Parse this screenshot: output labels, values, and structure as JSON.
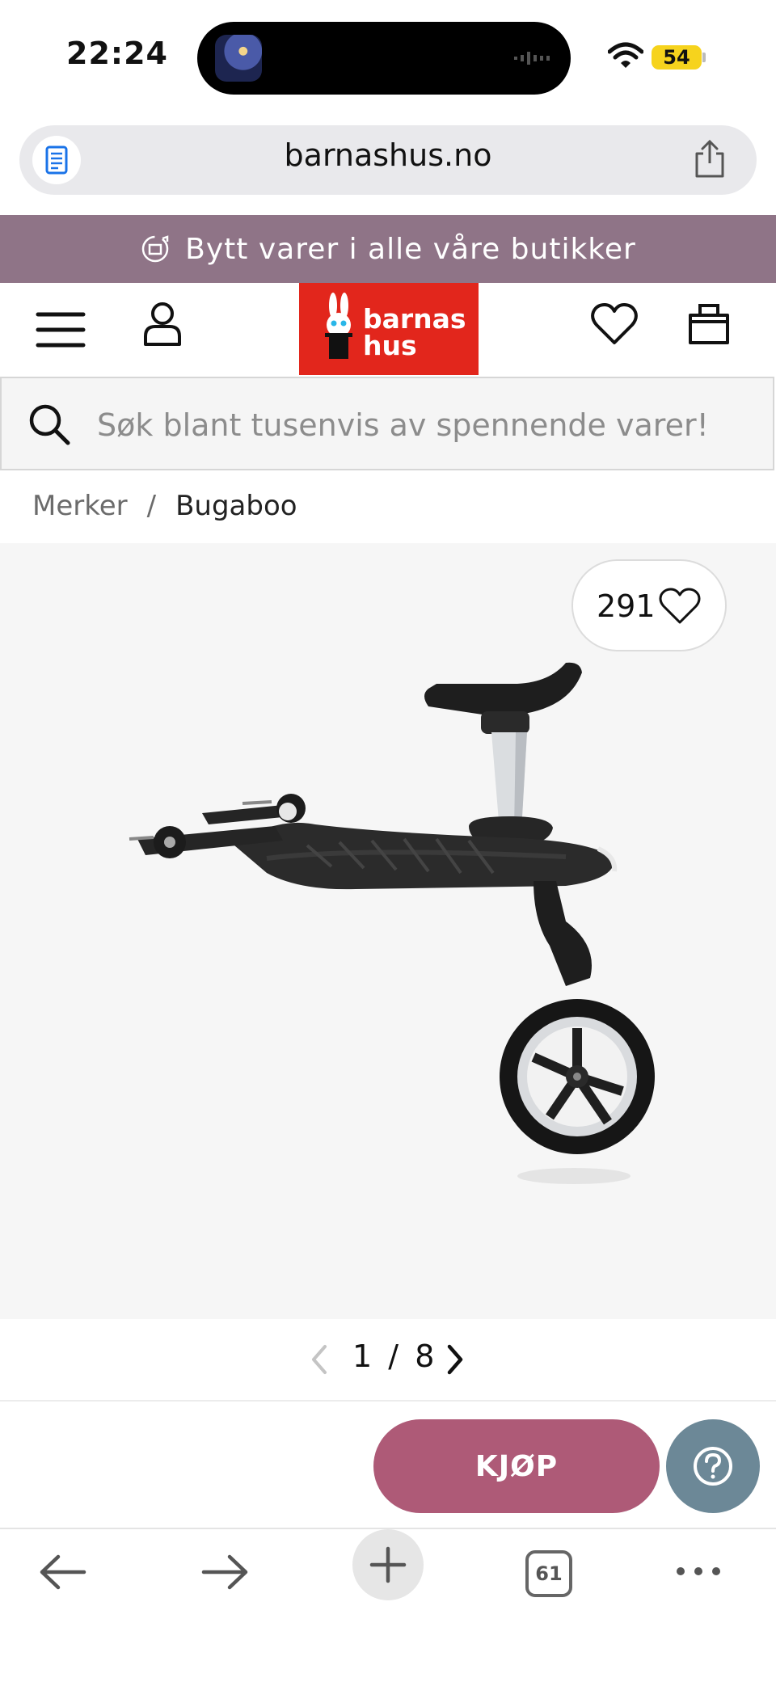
{
  "status_bar": {
    "time": "22:24",
    "battery": "54"
  },
  "browser": {
    "url": "barnashus.no",
    "tabs_count": "61"
  },
  "promo": {
    "text": "Bytt varer i alle våre butikker"
  },
  "header": {
    "logo_line1": "barnas",
    "logo_line2": "hus"
  },
  "search": {
    "placeholder": "Søk blant tusenvis av spennende varer!"
  },
  "breadcrumb": {
    "items": [
      "Merker",
      "Bugaboo"
    ],
    "separator": "/"
  },
  "product": {
    "favorites_count": "291",
    "image_index": "1",
    "image_total": "8",
    "pager_separator": "/"
  },
  "actions": {
    "buy_label": "KJØP"
  },
  "colors": {
    "promo_bg": "#8f7487",
    "logo_red": "#e2261c",
    "buy_bg": "#ae5a77",
    "help_bg": "#6c8897"
  }
}
